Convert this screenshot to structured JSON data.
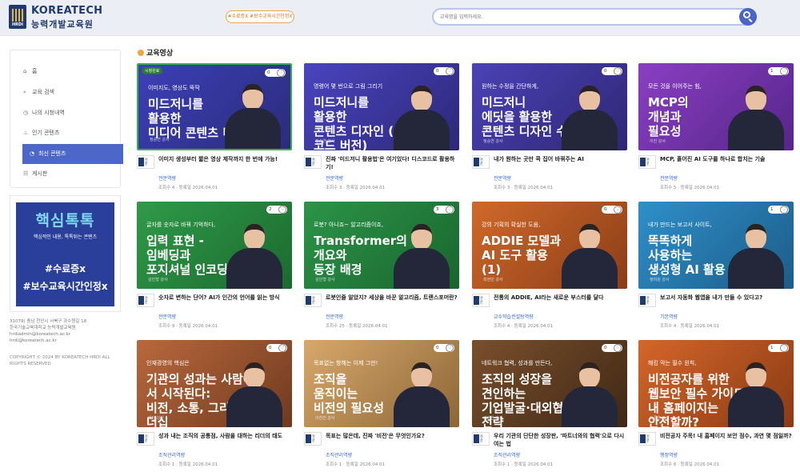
{
  "header": {
    "brand": "KOREATECH",
    "sub": "능력개발교육원",
    "logo_sub": "HRDI",
    "hashtags": "#수료증X #보수교육시간인정X",
    "search_placeholder": "교육명을 입력하세요."
  },
  "sidebar": {
    "items": [
      {
        "label": "홈",
        "icon": "home-icon",
        "glyph": "⌂"
      },
      {
        "label": "교육 검색",
        "icon": "search-icon",
        "glyph": "⌕"
      },
      {
        "label": "나의 시청내역",
        "icon": "history-icon",
        "glyph": "◷"
      },
      {
        "label": "인기 콘텐츠",
        "icon": "popular-icon",
        "glyph": "♨"
      },
      {
        "label": "최신 콘텐츠",
        "icon": "bell-icon",
        "glyph": "◔"
      },
      {
        "label": "게시판",
        "icon": "board-icon",
        "glyph": "☷"
      }
    ],
    "active_index": 4
  },
  "banner": {
    "title": "핵심톡톡",
    "sub": "핵심적인 내용, 톡톡튀는 콘텐츠",
    "line1": "#수료증x",
    "line2": "#보수교육시간인정x"
  },
  "footer": {
    "addr1": "31079) 충남 천안시 서북구 과수원길 18",
    "addr2": "한국기술교육대학교 능력개발교육원",
    "email1": "hrdiadmin@koreatech.ac.kr",
    "email2": "hrdi@koreatech.ac.kr",
    "copyright": "COPYRIGHT © 2024 BY KOREATECH HRDI ALL RIGHTS RESERVED"
  },
  "section_title": "교육영상",
  "cards": [
    {
      "title": "이미지 생성부터 짧은 영상 제작까지 한 번에 가능!",
      "category": "전문역량",
      "meta": "조회수 4 · 등록일 2026.04.01",
      "count": "0",
      "thumb_top": "이미지도, 영상도 뚝딱",
      "thumb_title": "미드저니를\n활용한\n미디어 콘텐츠 디자인",
      "thumb_name": "정승연 강사",
      "badge": "시청완료",
      "bg": "#3d3fb8",
      "bg2": "#2a2c7a"
    },
    {
      "title": "진짜 '미드저니 활용법'은 여기있다! 디스코드로 활용하기!",
      "category": "전문역량",
      "meta": "조회수 3 · 등록일 2026.04.01",
      "count": "0",
      "thumb_top": "명령어 몇 번으로 그림 그리기",
      "thumb_title": "미드저니를\n활용한\n콘텐츠 디자인 (디스코드 버전)",
      "thumb_name": "정승연 강사",
      "bg": "#4a44bf",
      "bg2": "#2c2878"
    },
    {
      "title": "내가 원하는 곳만 콕 집어 바꿔주는 AI",
      "category": "전문역량",
      "meta": "조회수 3 · 등록일 2026.04.01",
      "count": "0",
      "thumb_top": "원하는 수정을 간단하게,",
      "thumb_title": "미드저니\n에딧을 활용한\n콘텐츠 디자인 수정",
      "thumb_name": "정승연 강사",
      "bg": "#4b42b6",
      "bg2": "#2e2774"
    },
    {
      "title": "MCP, 흩어진 AI 도구를 하나로 합치는 기술",
      "category": "전문역량",
      "meta": "조회수 5 · 등록일 2026.04.01",
      "count": "1",
      "thumb_top": "모든 것을 이어주는 힘,",
      "thumb_title": "MCP의\n개념과\n필요성",
      "thumb_name": "이진 강사",
      "bg": "#8a3fc2",
      "bg2": "#56258a"
    },
    {
      "title": "숫자로 변하는 단어? AI가 인간의 언어를 읽는 방식",
      "category": "전문역량",
      "meta": "조회수 9 · 등록일 2026.04.01",
      "count": "2",
      "thumb_top": "글자를 숫자로 바꿔 기억하다,",
      "thumb_title": "입력 표현 -\n임베딩과\n포지셔널 인코딩",
      "thumb_name": "김민형 강사",
      "bg": "#2f9a49",
      "bg2": "#1b6a2e"
    },
    {
      "title": "로봇인줄 알았지? 세상을 바꾼 알고리즘, 트랜스포머란?",
      "category": "전문역량",
      "meta": "조회수 25 · 등록일 2026.04.01",
      "count": "3",
      "thumb_top": "로봇? 아니죠~ 알고리즘이죠,",
      "thumb_title": "Transformer의\n개요와\n등장 배경",
      "thumb_name": "김민형 강사",
      "bg": "#2c9448",
      "bg2": "#19652d"
    },
    {
      "title": "전통의 ADDIE, AI라는 새로운 부스터를 달다",
      "category": "교수학습컨설팅역량",
      "meta": "조회수 4 · 등록일 2026.04.01",
      "count": "0",
      "thumb_top": "강의 기획의 확실한 도움,",
      "thumb_title": "ADDIE 모델과\nAI 도구 활용\n(1)",
      "thumb_name": "최현민 강사",
      "bg": "#d0692a",
      "bg2": "#8a3d18"
    },
    {
      "title": "보고서 자동화 웹앱을 내가 만들 수 있다고?",
      "category": "기본역량",
      "meta": "조회수 4 · 등록일 2026.04.01",
      "count": "1",
      "thumb_top": "내가 만드는 보고서 사이트,",
      "thumb_title": "똑똑하게\n사용하는\n생성형 AI 활용",
      "thumb_name": "정미원 강사",
      "bg": "#2f8fc9",
      "bg2": "#1c5c88"
    },
    {
      "title": "성과 내는 조직의 공통점, 사람을 대하는 리더의 태도",
      "category": "조직관리역량",
      "meta": "조회수 1 · 등록일 2026.04.01",
      "count": "0",
      "thumb_top": "인재경영의 핵심은",
      "thumb_title": "기관의 성과는 사람에서 시작된다:\n비전, 소통, 그리고 리더십",
      "thumb_name": "대담 강사",
      "bg": "#b9683c",
      "bg2": "#6f3a1f"
    },
    {
      "title": "목표는 많은데, 진짜 '비전'은 무엇인가요?",
      "category": "조직관리역량",
      "meta": "조회수 1 · 등록일 2026.04.01",
      "count": "0",
      "thumb_top": "목표없는 항해는 이제 그만!",
      "thumb_title": "조직을\n움직이는\n비전의 필요성",
      "thumb_name": "이찬진 강사",
      "bg": "#d8a86b",
      "bg2": "#8c6637"
    },
    {
      "title": "우리 기관의 단단한 성장판, '파트너와의 협력'으로 다시 여는 법",
      "category": "조직관리역량",
      "meta": "조회수 1 · 등록일 2026.04.01",
      "count": "0",
      "thumb_top": "네트워크 협력, 성과를 만든다,",
      "thumb_title": "조직의 성장을\n견인하는\n기업발굴·대외협력\n전략",
      "thumb_name": "권현한 강사",
      "bg": "#7a4f2c",
      "bg2": "#3f2815"
    },
    {
      "title": "비전공자 주목! 내 홈페이지 보안 점수, 과연 몇 점일까?",
      "category": "행정역량",
      "meta": "조회수 6 · 등록일 2026.04.01",
      "count": "1",
      "thumb_top": "해킹 막는 필수 원칙,",
      "thumb_title": "비전공자를 위한\n웹보안 필수 가이드:\n내 홈페이지는\n안전할까?",
      "thumb_name": "이준연 강사",
      "bg": "#d4662a",
      "bg2": "#8a3a14"
    }
  ]
}
